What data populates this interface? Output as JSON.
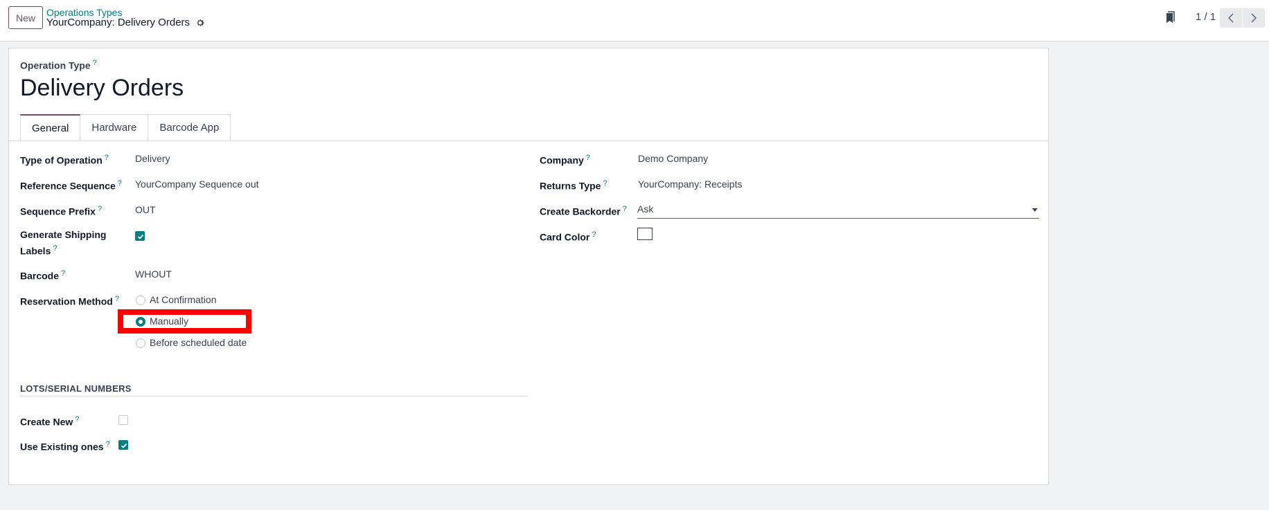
{
  "control_panel": {
    "new_label": "New",
    "breadcrumb_parent": "Operations Types",
    "breadcrumb_current": "YourCompany: Delivery Orders",
    "pager_value": "1 / 1"
  },
  "form": {
    "operation_type_label": "Operation Type",
    "help_mark": "?",
    "title": "Delivery Orders",
    "tabs": [
      {
        "label": "General",
        "active": true
      },
      {
        "label": "Hardware",
        "active": false
      },
      {
        "label": "Barcode App",
        "active": false
      }
    ],
    "left_fields": {
      "type_of_operation": {
        "label": "Type of Operation",
        "value": "Delivery"
      },
      "reference_sequence": {
        "label": "Reference Sequence",
        "value": "YourCompany Sequence out"
      },
      "sequence_prefix": {
        "label": "Sequence Prefix",
        "value": "OUT"
      },
      "generate_shipping_labels": {
        "label_line1": "Generate Shipping",
        "label_line2": "Labels",
        "checked": true
      },
      "barcode": {
        "label": "Barcode",
        "value": "WHOUT"
      },
      "reservation_method": {
        "label": "Reservation Method",
        "options": [
          "At Confirmation",
          "Manually",
          "Before scheduled date"
        ],
        "selected": "Manually"
      }
    },
    "lots_section": {
      "title": "LOTS/SERIAL NUMBERS",
      "create_new": {
        "label": "Create New",
        "checked": false
      },
      "use_existing": {
        "label": "Use Existing ones",
        "checked": true
      }
    },
    "right_fields": {
      "company": {
        "label": "Company",
        "value": "Demo Company"
      },
      "returns_type": {
        "label": "Returns Type",
        "value": "YourCompany: Receipts"
      },
      "create_backorder": {
        "label": "Create Backorder",
        "value": "Ask"
      },
      "card_color": {
        "label": "Card Color",
        "color": "#ffffff"
      }
    }
  },
  "colors": {
    "brand": "#714b67",
    "accent": "#017e84",
    "highlight": "#ff0000"
  }
}
